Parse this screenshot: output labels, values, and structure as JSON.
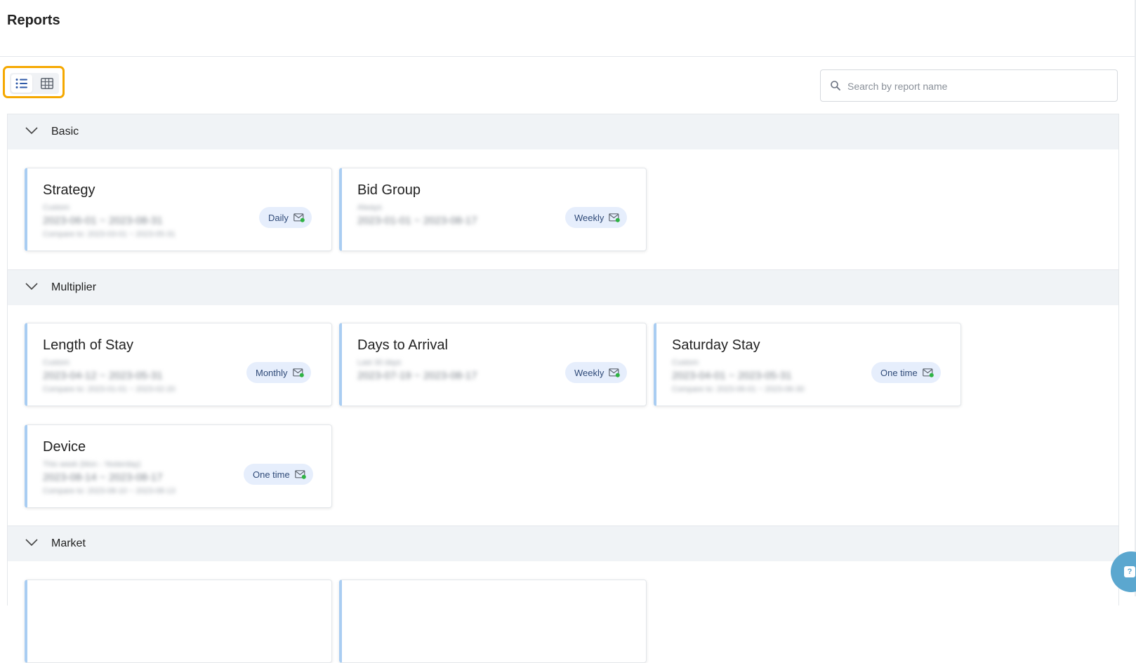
{
  "header": {
    "title": "Reports"
  },
  "toolbar": {
    "search_placeholder": "Search by report name"
  },
  "groups": [
    {
      "title": "Basic",
      "cards": [
        {
          "title": "Strategy",
          "period": "Custom",
          "range": "2023-06-01 ~ 2023-08-31",
          "compare": "Compare to: 2023-03-01 ~ 2023-05-31",
          "frequency": "Daily"
        },
        {
          "title": "Bid Group",
          "period": "Always",
          "range": "2023-01-01 ~ 2023-08-17",
          "frequency": "Weekly"
        }
      ]
    },
    {
      "title": "Multiplier",
      "cards": [
        {
          "title": "Length of Stay",
          "period": "Custom",
          "range": "2023-04-12 ~ 2023-05-31",
          "compare": "Compare to: 2023-01-01 ~ 2023-02-20",
          "frequency": "Monthly"
        },
        {
          "title": "Days to Arrival",
          "period": "Last 30 days",
          "range": "2023-07-19 ~ 2023-08-17",
          "frequency": "Weekly"
        },
        {
          "title": "Saturday Stay",
          "period": "Custom",
          "range": "2023-04-01 ~ 2023-05-31",
          "compare": "Compare to: 2023-06-01 ~ 2023-06-30",
          "frequency": "One time"
        },
        {
          "title": "Device",
          "period": "This week (Mon - Yesterday)",
          "range": "2023-08-14 ~ 2023-08-17",
          "compare": "Compare to: 2023-08-10 ~ 2023-08-13",
          "frequency": "One time"
        }
      ]
    },
    {
      "title": "Market",
      "cards": []
    }
  ],
  "icons": {
    "view_list": "list-view-icon",
    "view_grid": "grid-view-icon",
    "search": "search-icon",
    "chevron": "chevron-down-icon",
    "schedule": "scheduled-email-icon",
    "help": "help-chat-icon"
  },
  "colors": {
    "accent_highlight": "#f5a800",
    "card_border_accent": "#a9cdf2",
    "badge_bg": "#e6eefc",
    "badge_text": "#2f4a78",
    "group_header_bg": "#f0f3f6",
    "mail_dot": "#2fb344"
  }
}
